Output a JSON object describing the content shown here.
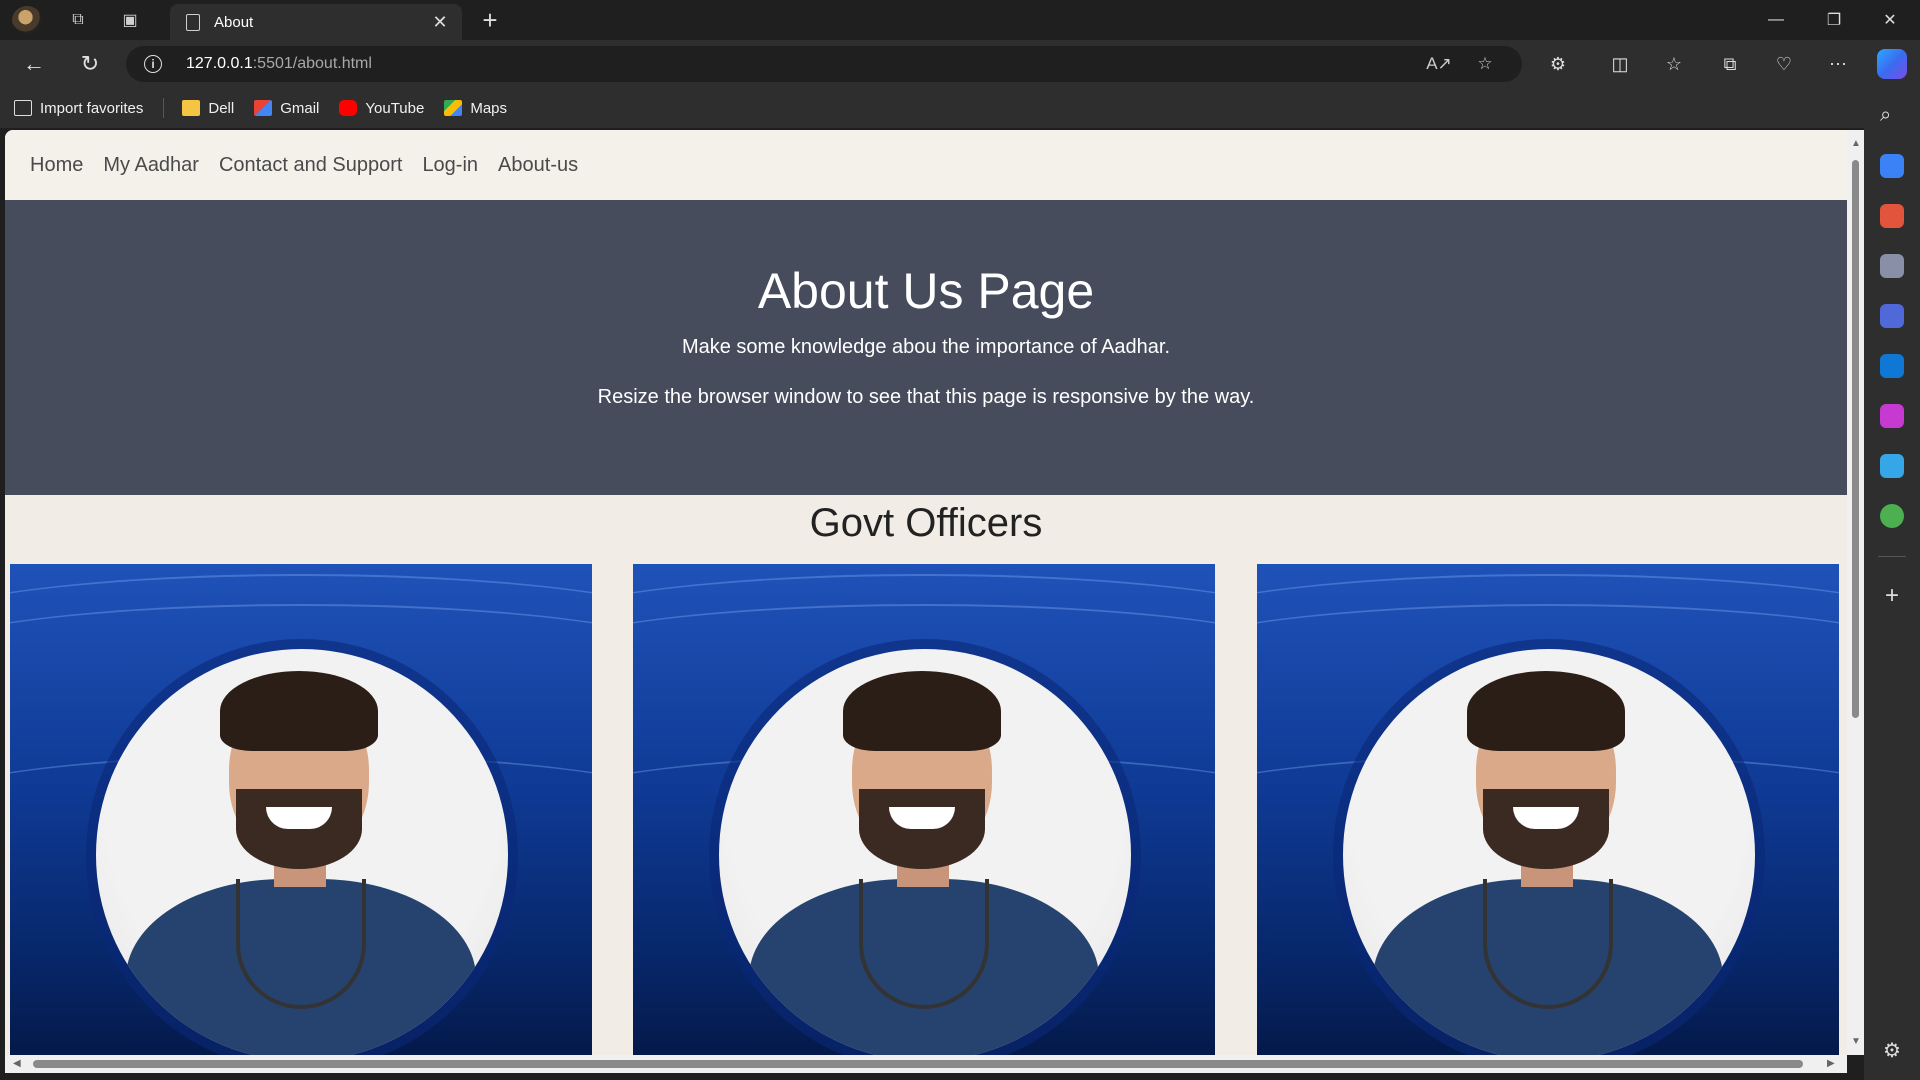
{
  "browser": {
    "tab_title": "About",
    "url_host": "127.0.0.1",
    "url_rest": ":5501/about.html",
    "bookmarks": [
      "Import favorites",
      "Dell",
      "Gmail",
      "YouTube",
      "Maps"
    ]
  },
  "site": {
    "nav": [
      "Home",
      "My Aadhar",
      "Contact and Support",
      "Log-in",
      "About-us"
    ],
    "hero_title": "About Us Page",
    "hero_line1": "Make some knowledge abou the importance of Aadhar.",
    "hero_line2": "Resize the browser window to see that this page is responsive by the way.",
    "section_title": "Govt Officers"
  }
}
